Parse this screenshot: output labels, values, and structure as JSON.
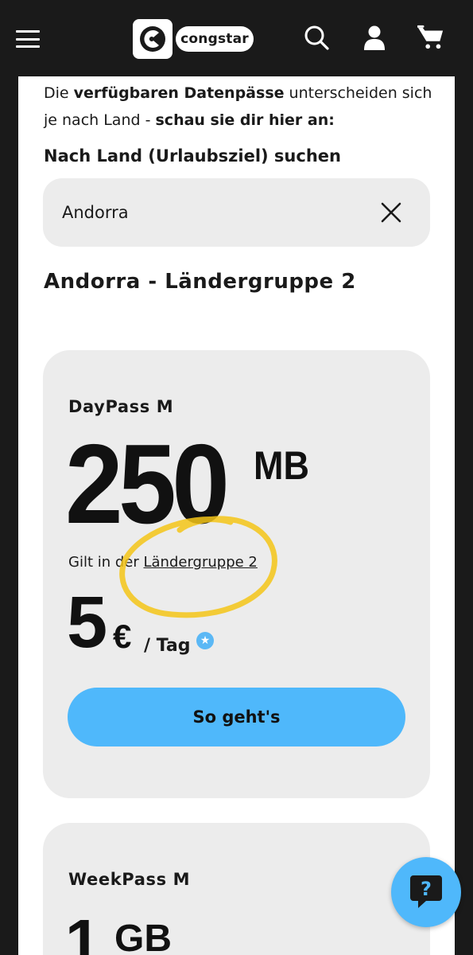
{
  "header": {
    "brand": "congstar",
    "icons": [
      "menu-icon",
      "search-icon",
      "user-icon",
      "cart-icon"
    ]
  },
  "intro": {
    "part1": "Die ",
    "bold1": "verfügbaren Datenpässe",
    "part2": " unterscheiden sich je nach Land - ",
    "bold2": "schau sie dir hier an:"
  },
  "search": {
    "label": "Nach Land (Urlaubsziel) suchen",
    "value": "Andorra"
  },
  "country_title": "Andorra - Ländergruppe 2",
  "passes": [
    {
      "title": "DayPass M",
      "volume": "250",
      "unit": "MB",
      "valid_prefix": "Gilt in der ",
      "valid_link": "Ländergruppe 2",
      "price": "5",
      "currency": "€",
      "per": "/ Tag",
      "cta": "So geht's"
    },
    {
      "title": "WeekPass M",
      "volume": "1",
      "unit": "GB"
    }
  ],
  "colors": {
    "accent": "#4fb8fb",
    "background": "#1a1a1a",
    "card": "#ececec",
    "highlight": "#f5c518"
  }
}
